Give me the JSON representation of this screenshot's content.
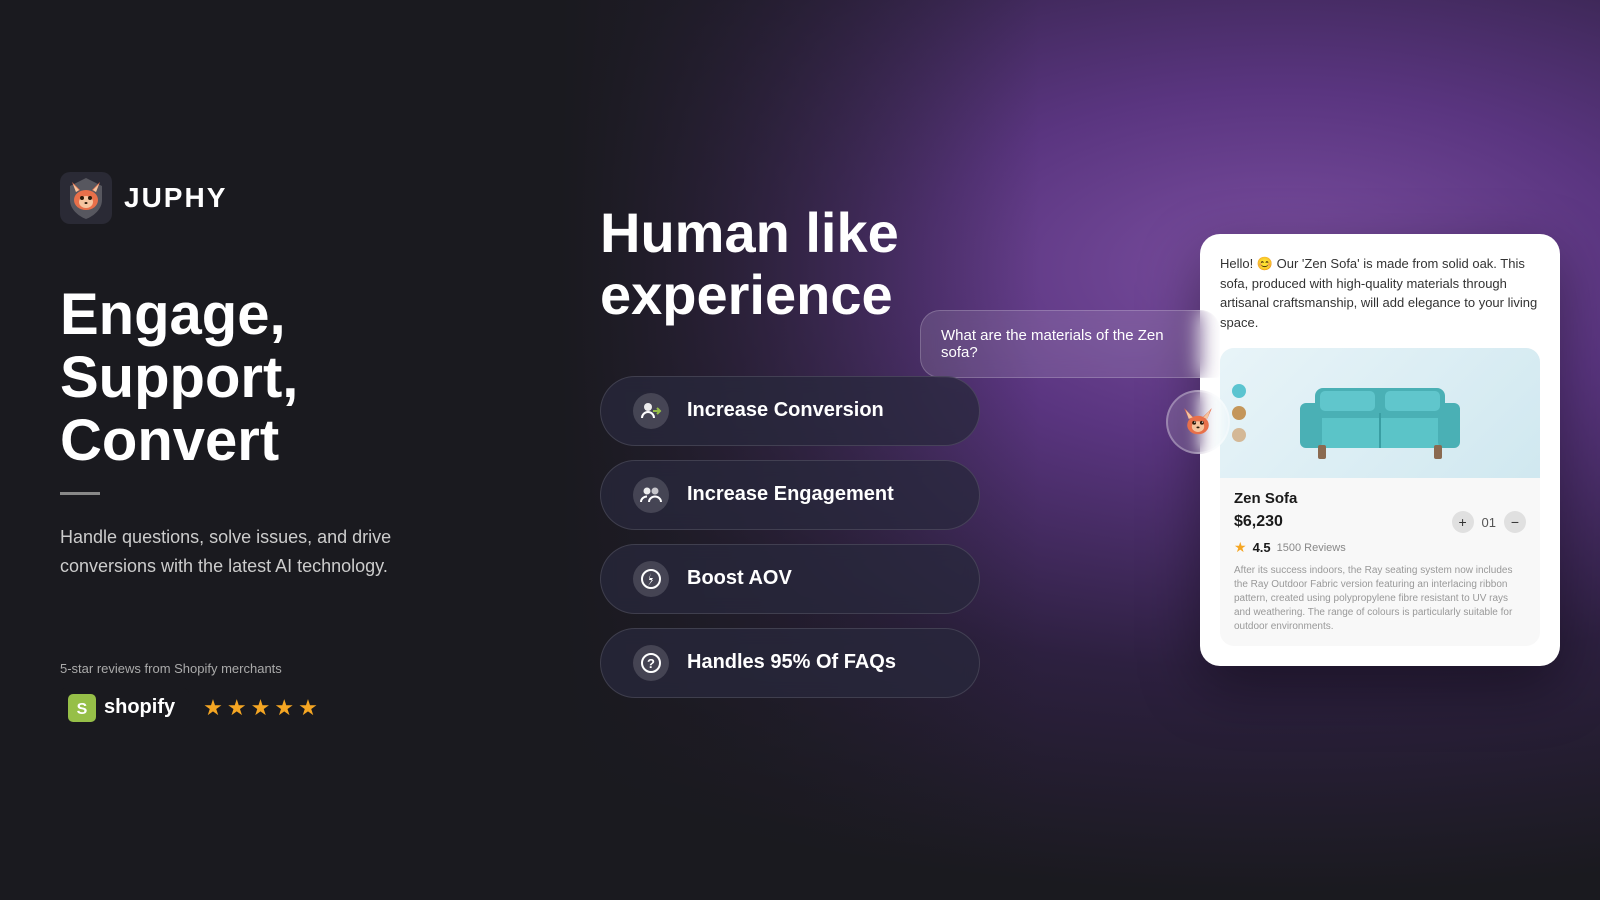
{
  "brand": {
    "name": "JUPHY",
    "logo_emoji": "🦊"
  },
  "left": {
    "headline_line1": "Engage,",
    "headline_line2": "Support,",
    "headline_line3": "Convert",
    "subtext": "Handle questions, solve issues, and drive conversions with the latest AI technology.",
    "review_label": "5-star reviews from Shopify merchants",
    "shopify_label": "shopify",
    "stars": [
      "★",
      "★",
      "★",
      "★",
      "★"
    ]
  },
  "right": {
    "section_title_line1": "Human like",
    "section_title_line2": "experience",
    "features": [
      {
        "id": "conversion",
        "label": "Increase Conversion",
        "icon": "👤"
      },
      {
        "id": "engagement",
        "label": "Increase Engagement",
        "icon": "👥"
      },
      {
        "id": "aov",
        "label": "Boost AOV",
        "icon": "⚡"
      },
      {
        "id": "faqs",
        "label": "Handles 95% Of FAQs",
        "icon": "❓"
      }
    ]
  },
  "chat": {
    "question": "What are the materials of the Zen sofa?",
    "reply": "Hello! 😊 Our 'Zen Sofa' is made from solid oak. This sofa, produced with high-quality materials through artisanal craftsmanship, will add elegance to your living space.",
    "product": {
      "name": "Zen Sofa",
      "price": "$6,230",
      "qty": "01",
      "rating": "4.5",
      "review_count": "1500 Reviews",
      "desc": "After its success indoors, the Ray seating system now includes the Ray Outdoor Fabric version featuring an interlacing ribbon pattern, created using polypropylene fibre resistant to UV rays and weathering. The range of colours is particularly suitable for outdoor environments.",
      "colors": [
        "#5bc4d0",
        "#c4965a",
        "#d4b896"
      ]
    }
  }
}
